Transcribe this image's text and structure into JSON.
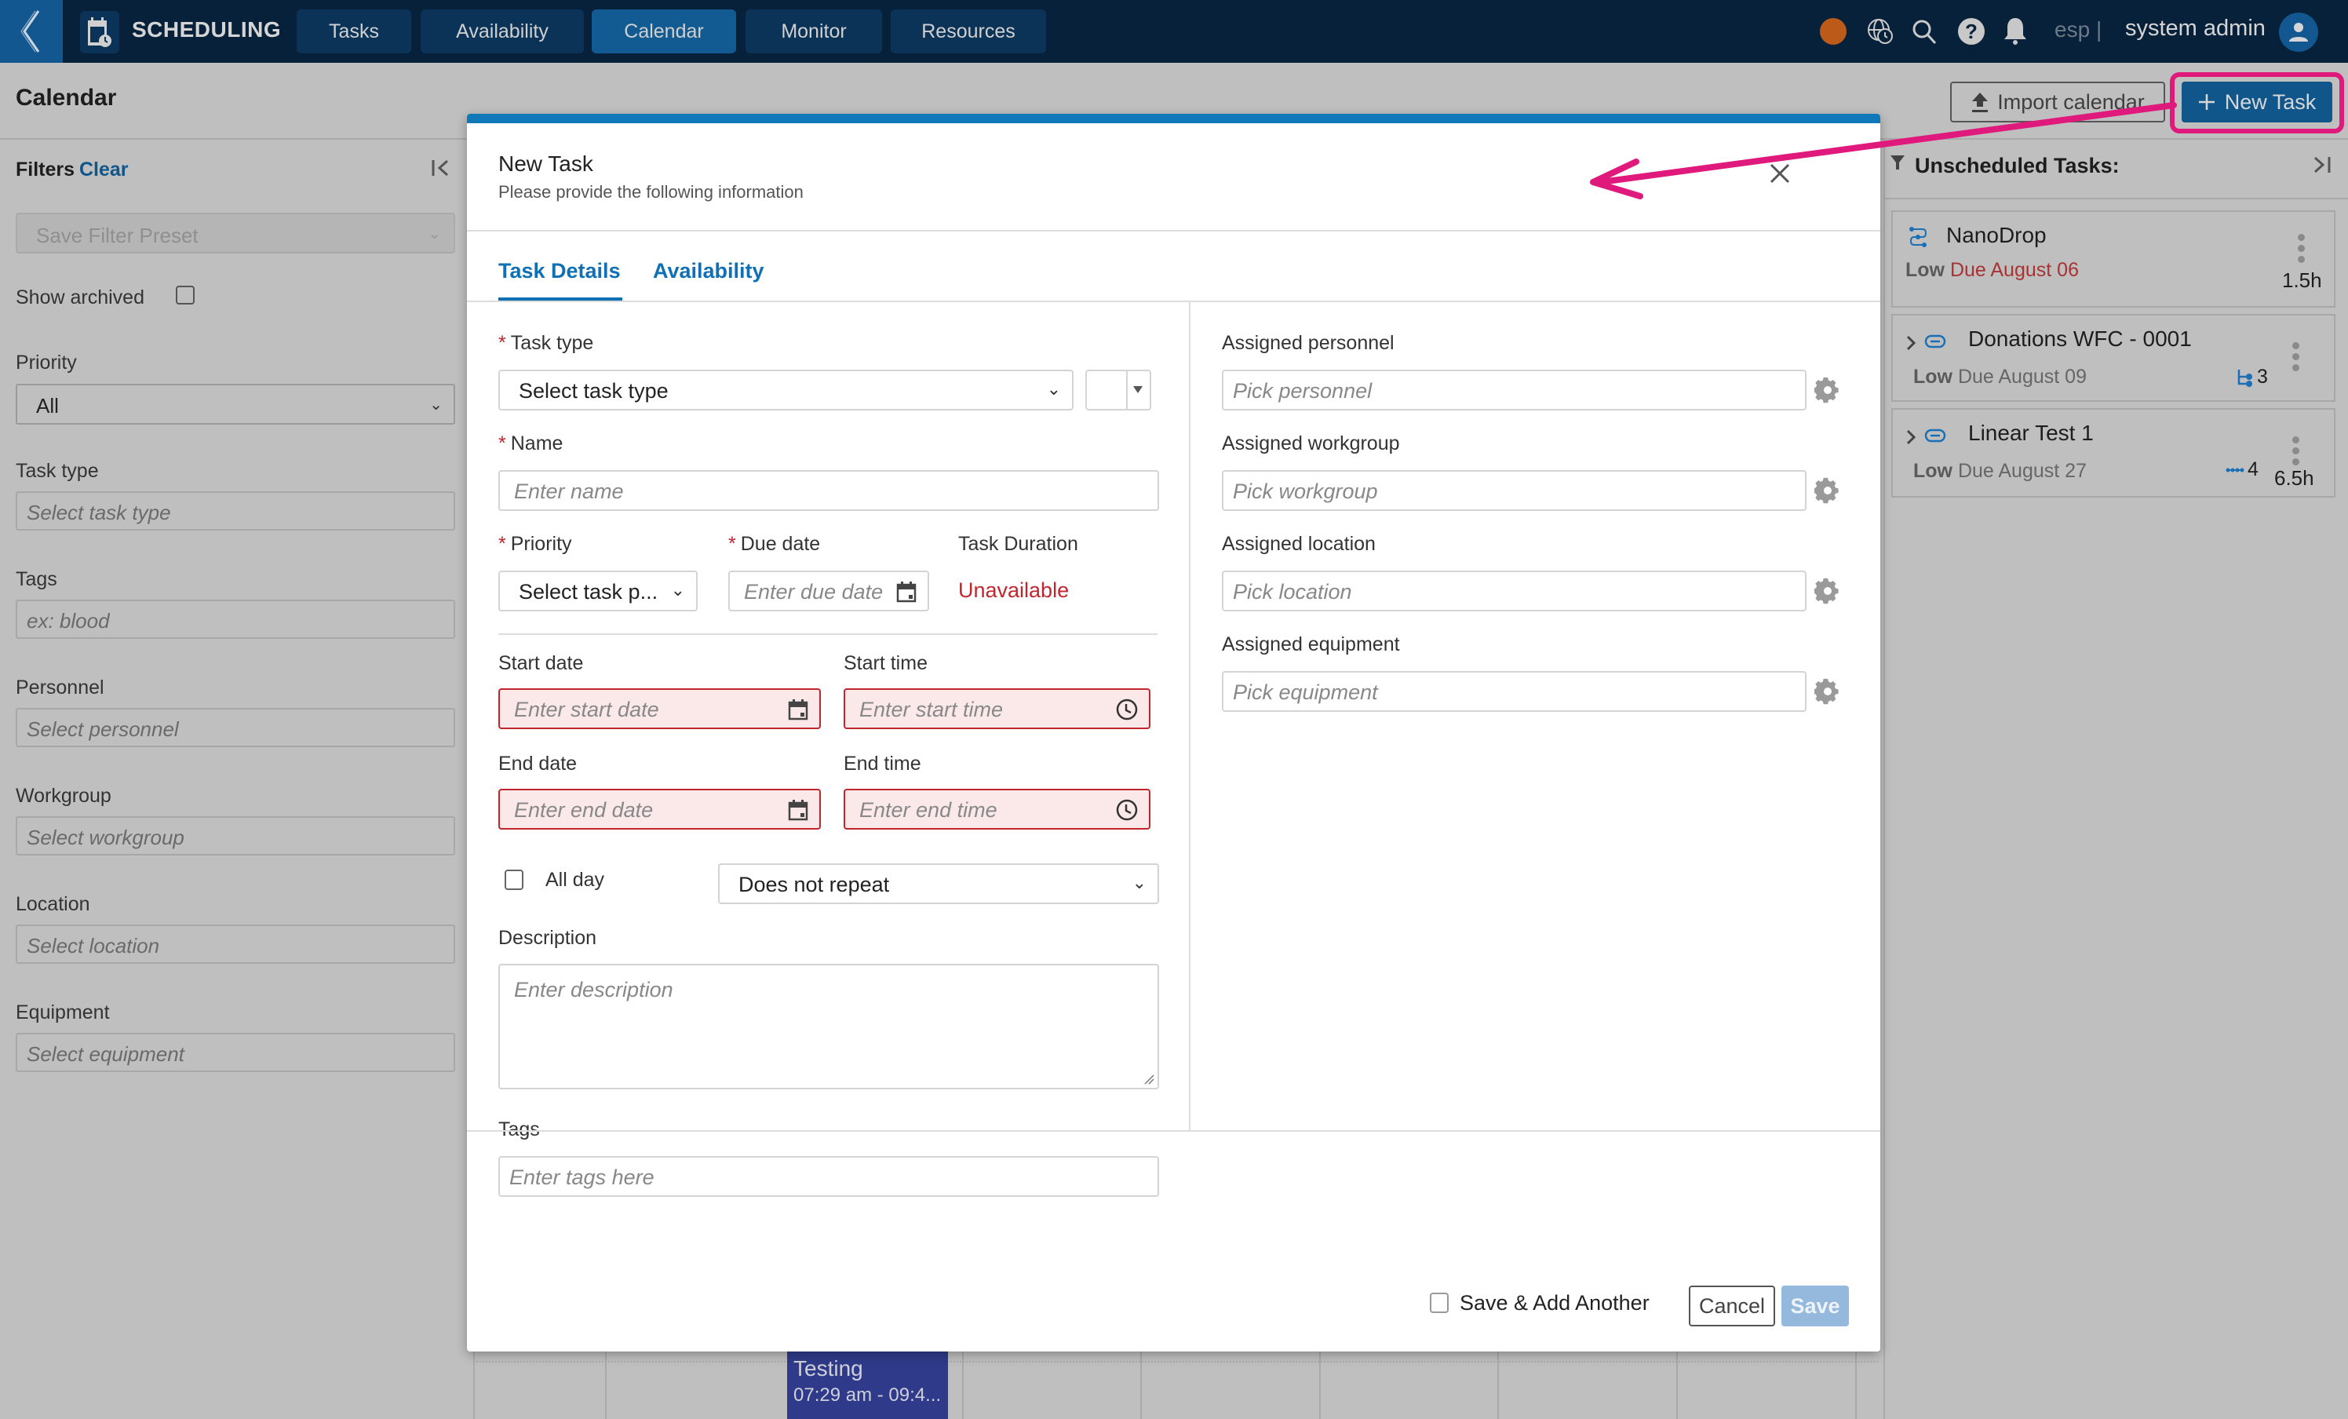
{
  "header": {
    "app_name": "SCHEDULING",
    "nav_tabs": [
      {
        "label": "Tasks",
        "active": false
      },
      {
        "label": "Availability",
        "active": false
      },
      {
        "label": "Calendar",
        "active": true
      },
      {
        "label": "Monitor",
        "active": false
      },
      {
        "label": "Resources",
        "active": false
      }
    ],
    "status_dot_color": "#d2691e",
    "icons": [
      "globe-clock-icon",
      "search-icon",
      "help-icon",
      "bell-icon"
    ],
    "language": "esp",
    "language_separator": "|",
    "user_name": "system admin"
  },
  "page": {
    "title": "Calendar",
    "import_label": "Import calendar",
    "new_task_label": "New Task"
  },
  "filters": {
    "title": "Filters",
    "clear_label": "Clear",
    "preset_placeholder": "Save Filter Preset",
    "show_archived_label": "Show archived",
    "show_archived_checked": false,
    "priority_label": "Priority",
    "priority_value": "All",
    "task_type_label": "Task type",
    "task_type_placeholder": "Select task type",
    "tags_label": "Tags",
    "tags_placeholder": "ex: blood",
    "personnel_label": "Personnel",
    "personnel_placeholder": "Select personnel",
    "workgroup_label": "Workgroup",
    "workgroup_placeholder": "Select workgroup",
    "location_label": "Location",
    "location_placeholder": "Select location",
    "equipment_label": "Equipment",
    "equipment_placeholder": "Select equipment"
  },
  "unscheduled": {
    "title": "Unscheduled Tasks:",
    "tasks": [
      {
        "name": "NanoDrop",
        "priority": "Low",
        "due": "Due August 06",
        "overdue": true,
        "duration": "1.5h",
        "icon": "workflow-icon"
      },
      {
        "name": "Donations WFC - 0001",
        "priority": "Low",
        "due": "Due August 09",
        "overdue": false,
        "sub_count": "3",
        "sub_icon": "subtasks-tree-icon",
        "icon": "link-icon"
      },
      {
        "name": "Linear Test 1",
        "priority": "Low",
        "due": "Due August 27",
        "overdue": false,
        "sub_count": "4",
        "sub_icon": "linear-chain-icon",
        "duration": "6.5h",
        "icon": "link-icon"
      }
    ]
  },
  "calendar_bg": {
    "event": {
      "title": "Testing",
      "time": "07:29 am - 09:4..."
    }
  },
  "modal": {
    "title": "New Task",
    "subtitle": "Please provide the following information",
    "tabs": [
      {
        "label": "Task Details",
        "active": true
      },
      {
        "label": "Availability",
        "active": false
      }
    ],
    "left": {
      "task_type_label": "Task type",
      "task_type_value": "Select task type",
      "name_label": "Name",
      "name_placeholder": "Enter name",
      "priority_label": "Priority",
      "priority_value": "Select task p...",
      "due_date_label": "Due date",
      "due_date_placeholder": "Enter due date",
      "duration_label": "Task Duration",
      "duration_value": "Unavailable",
      "start_date_label": "Start date",
      "start_date_placeholder": "Enter start date",
      "start_time_label": "Start time",
      "start_time_placeholder": "Enter start time",
      "end_date_label": "End date",
      "end_date_placeholder": "Enter end date",
      "end_time_label": "End time",
      "end_time_placeholder": "Enter end time",
      "all_day_label": "All day",
      "all_day_checked": false,
      "repeat_value": "Does not repeat",
      "description_label": "Description",
      "description_placeholder": "Enter description",
      "tags_label": "Tags",
      "tags_placeholder": "Enter tags here"
    },
    "right": {
      "personnel_label": "Assigned personnel",
      "personnel_placeholder": "Pick personnel",
      "workgroup_label": "Assigned workgroup",
      "workgroup_placeholder": "Pick workgroup",
      "location_label": "Assigned location",
      "location_placeholder": "Pick location",
      "equipment_label": "Assigned equipment",
      "equipment_placeholder": "Pick equipment"
    },
    "footer": {
      "save_add_another_label": "Save & Add Another",
      "save_add_another_checked": false,
      "cancel_label": "Cancel",
      "save_label": "Save"
    }
  },
  "colors": {
    "header_bg": "#08213a",
    "primary": "#10568b",
    "modal_accent": "#1077b9",
    "error": "#c0262d",
    "annotation": "#e0197d"
  }
}
